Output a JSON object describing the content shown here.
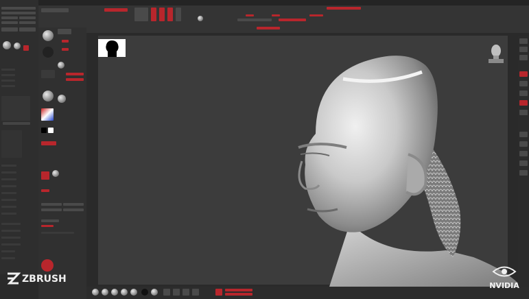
{
  "brand": {
    "logo_text": "ZBRUSH",
    "partner_text": "NVIDIA"
  },
  "colors": {
    "accent": "#b8262c",
    "panel_bg": "#303030",
    "canvas_bg": "#3c3c3c"
  },
  "icons": {
    "zbrush_logo": "zbrush-z-icon",
    "nvidia_logo": "nvidia-eye-icon",
    "navigation_head": "head-navigator-icon",
    "material_sphere": "sphere-icon"
  }
}
